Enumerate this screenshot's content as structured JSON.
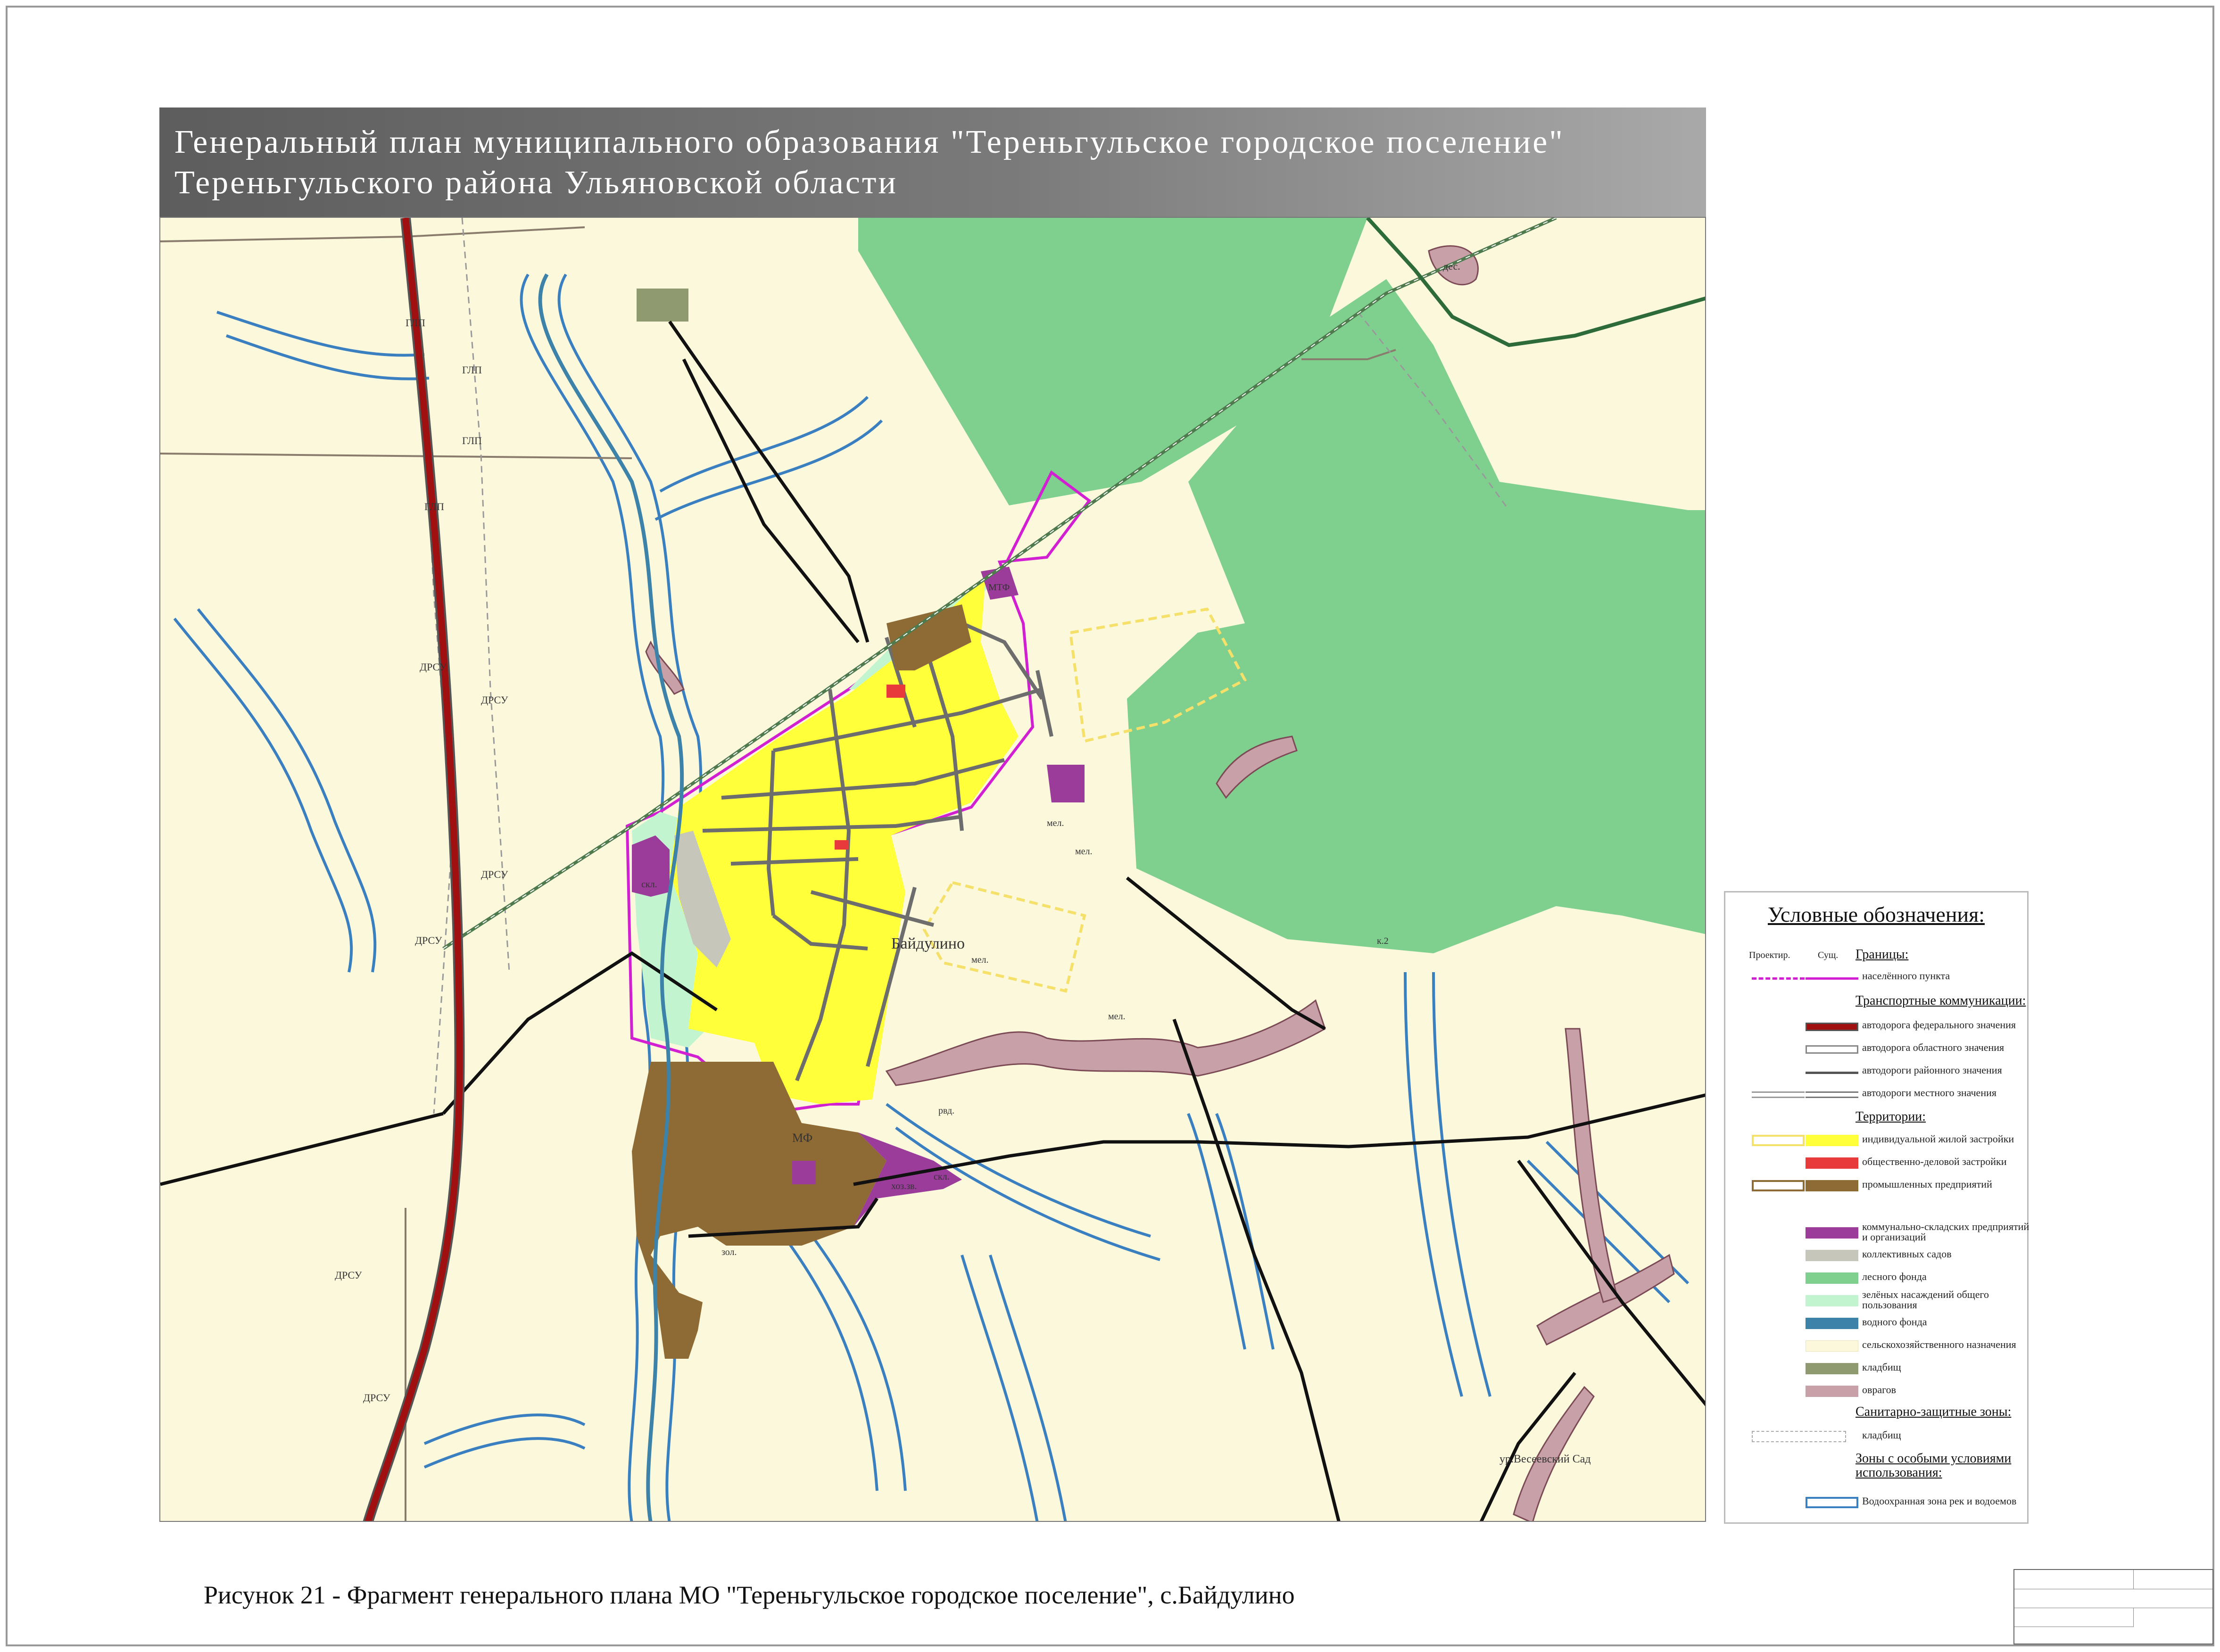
{
  "title": {
    "line1": "Генеральный план муниципального образования \"Тереньгульское городское поселение\"",
    "line2": "Тереньгульского района Ульяновской области"
  },
  "caption": "Рисунок 21 - Фрагмент генерального плана МО \"Тереньгульское городское поселение\", с.Байдулино",
  "map": {
    "settlement_label": "Байдулино",
    "labels": [
      "ГЛП",
      "ГЛП",
      "ГЛП",
      "ГЛП",
      "ДРСУ",
      "ДРСУ",
      "ДРСУ",
      "ДРСУ",
      "ДРСУ",
      "ДРСУ",
      "МФ",
      "МТФ",
      "скл.",
      "скл.",
      "хоз.зв.",
      "мел.",
      "мел.",
      "мел.",
      "мел.",
      "рвд.",
      "зол.",
      "дес.",
      "ур.Весеевский Сад",
      "Байдулино",
      "к.2"
    ],
    "colors": {
      "agricultural": "#fbf8dc",
      "forest": "#7fcf8f",
      "residential": "#ffff3a",
      "public_business": "#e83a3a",
      "industrial": "#8e6a35",
      "communal_storage": "#9b3c9b",
      "gardens": "#c6c6bb",
      "greenery": "#c2f5cf",
      "water": "#3d82a8",
      "cemetery": "#8f9a70",
      "ravines": "#c8a0a8",
      "boundary": "#d21fd2",
      "federal_road": "#a01010",
      "water_protection": "#3a7fc0"
    }
  },
  "legend": {
    "title": "Условные обозначения:",
    "col_planned": "Проектир.",
    "col_existing": "Сущ.",
    "sections": {
      "borders": "Границы:",
      "transport": "Транспортные коммуникации:",
      "territories": "Территории:",
      "sanitary": "Санитарно-защитные зоны:",
      "special": "Зоны с особыми условиями использования:"
    },
    "items": {
      "settlement_border": "населённого пункта",
      "road_federal": "автодорога федерального значения",
      "road_regional": "автодорога областного значения",
      "road_district": "автодороги районного значения",
      "road_local": "автодороги местного значения",
      "residential": "индивидуальной жилой застройки",
      "public": "общественно-деловой застройки",
      "industrial": "промышленных предприятий",
      "communal_1": "коммунально-складских предприятий",
      "communal_2": "и организаций",
      "gardens": "коллективных садов",
      "forest": "лесного фонда",
      "greenery_1": "зелёных насаждений общего",
      "greenery_2": "пользования",
      "water": "водного фонда",
      "agricultural": "сельскохозяйственного назначения",
      "cemeteries": "кладбищ",
      "ravines": "оврагов",
      "sanitary_cemeteries": "кладбищ",
      "water_protection": "Водоохранная зона рек и водоемов"
    }
  }
}
